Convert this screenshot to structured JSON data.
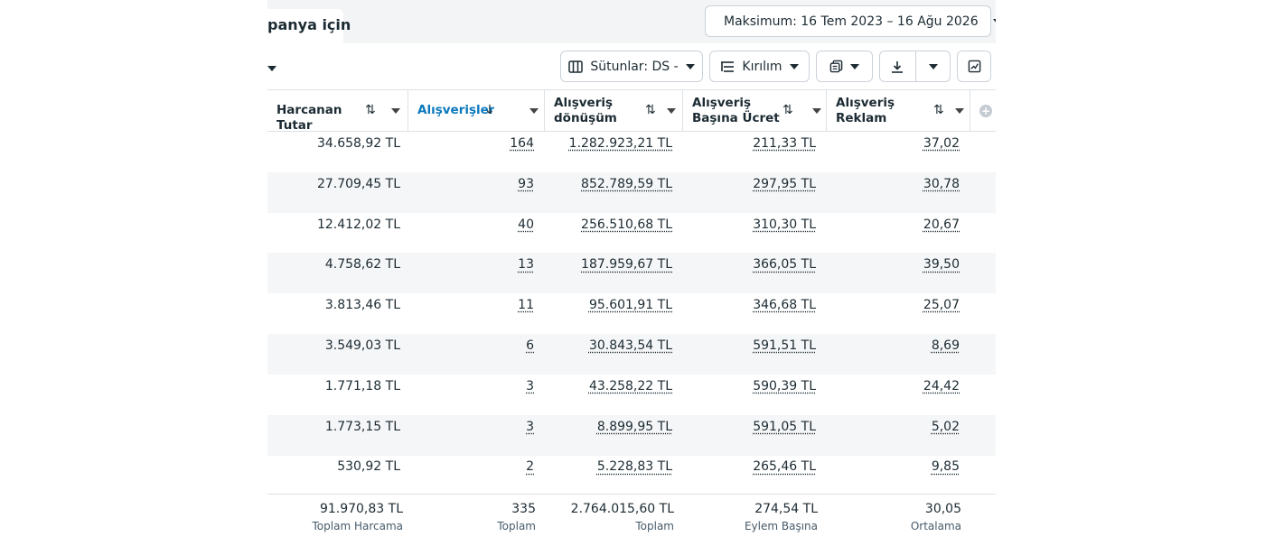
{
  "tab": {
    "label": "panya için"
  },
  "date_range": {
    "label": "Maksimum: 16 Tem 2023 – 16 Ağu 2026"
  },
  "toolbar": {
    "columns_label": "Sütunlar: DS -",
    "breakdown_label": "Kırılım"
  },
  "columns": [
    {
      "label": "Harcanan Tutar",
      "sort": "⇅"
    },
    {
      "label": "Alışverişler",
      "sort": "↓"
    },
    {
      "label": "Alışveriş dönüşüm",
      "sort": "⇅"
    },
    {
      "label": "Alışveriş Başına Ücret",
      "sort": "⇅"
    },
    {
      "label": "Alışveriş Reklam Harcamasının",
      "sort": "⇅"
    }
  ],
  "rows": [
    [
      "34.658,92 TL",
      "164",
      "1.282.923,21 TL",
      "211,33 TL",
      "37,02"
    ],
    [
      "27.709,45 TL",
      "93",
      "852.789,59 TL",
      "297,95 TL",
      "30,78"
    ],
    [
      "12.412,02 TL",
      "40",
      "256.510,68 TL",
      "310,30 TL",
      "20,67"
    ],
    [
      "4.758,62 TL",
      "13",
      "187.959,67 TL",
      "366,05 TL",
      "39,50"
    ],
    [
      "3.813,46 TL",
      "11",
      "95.601,91 TL",
      "346,68 TL",
      "25,07"
    ],
    [
      "3.549,03 TL",
      "6",
      "30.843,54 TL",
      "591,51 TL",
      "8,69"
    ],
    [
      "1.771,18 TL",
      "3",
      "43.258,22 TL",
      "590,39 TL",
      "24,42"
    ],
    [
      "1.773,15 TL",
      "3",
      "8.899,95 TL",
      "591,05 TL",
      "5,02"
    ],
    [
      "530,92 TL",
      "2",
      "5.228,83 TL",
      "265,46 TL",
      "9,85"
    ]
  ],
  "totals": [
    {
      "value": "91.970,83 TL",
      "sub": "Toplam Harcama"
    },
    {
      "value": "335",
      "sub": "Toplam"
    },
    {
      "value": "2.764.015,60 TL",
      "sub": "Toplam"
    },
    {
      "value": "274,54 TL",
      "sub": "Eylem Başına"
    },
    {
      "value": "30,05",
      "sub": "Ortalama"
    }
  ]
}
